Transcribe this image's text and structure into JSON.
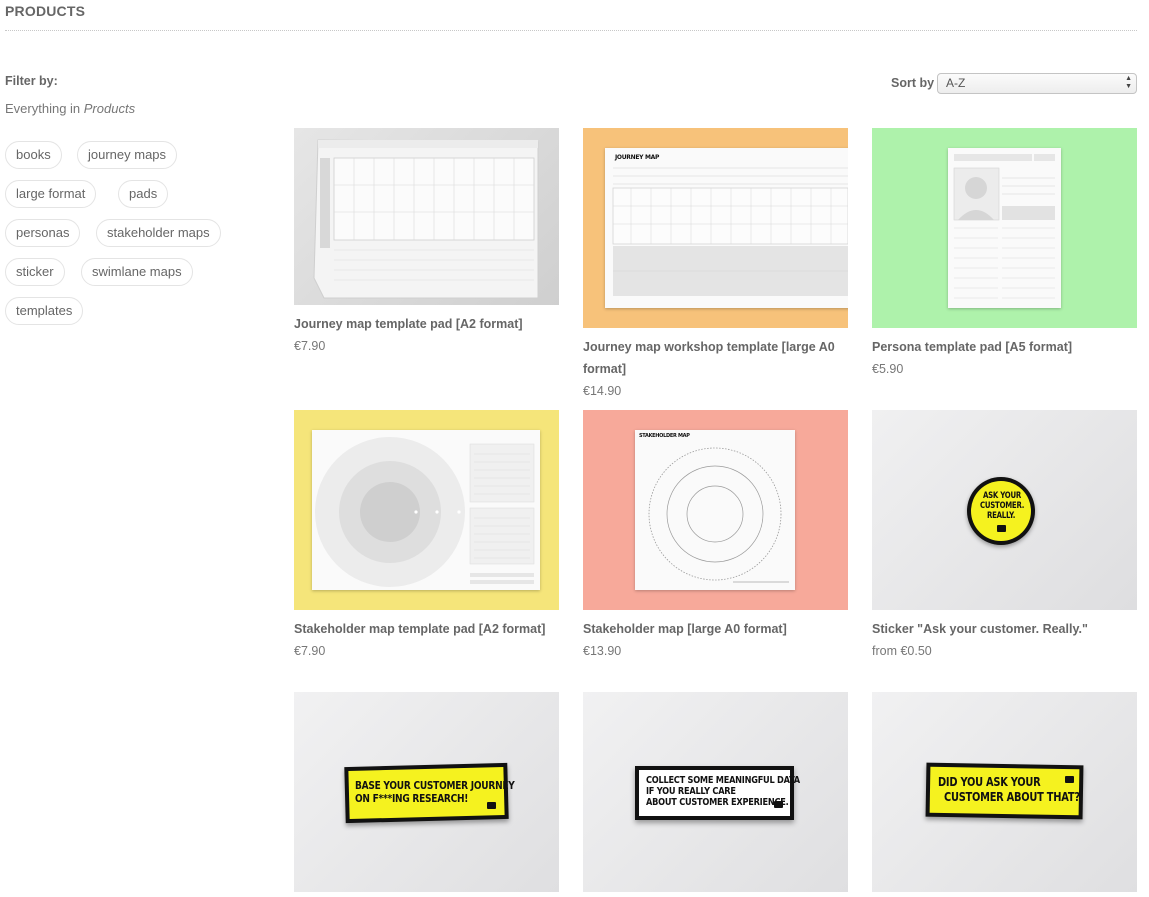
{
  "page": {
    "title": "PRODUCTS"
  },
  "filter": {
    "label": "Filter by:",
    "scope_prefix": "Everything in ",
    "scope_category": "Products",
    "tags": [
      "books",
      "journey maps",
      "large format",
      "pads",
      "personas",
      "stakeholder maps",
      "sticker",
      "swimlane maps",
      "templates"
    ]
  },
  "sort": {
    "label": "Sort by",
    "selected": "A-Z"
  },
  "products": [
    {
      "name": "Journey map template pad [A2 format]",
      "price": "€7.90",
      "bg": "#d9d9d9"
    },
    {
      "name": "Journey map workshop template [large A0 format]",
      "price": "€14.90",
      "bg": "#f7c27a"
    },
    {
      "name": "Persona template pad [A5 format]",
      "price": "€5.90",
      "bg": "#aef2ab"
    },
    {
      "name": "Stakeholder map template pad [A2 format]",
      "price": "€7.90",
      "bg": "#f5e57a"
    },
    {
      "name": "Stakeholder map [large A0 format]",
      "price": "€13.90",
      "bg": "#f7a99a"
    },
    {
      "name": "Sticker \"Ask your customer. Really.\"",
      "price": "from €0.50",
      "bg": "#e8e8e9"
    },
    {
      "name": "",
      "price": "",
      "bg": "#ececed"
    },
    {
      "name": "",
      "price": "",
      "bg": "#ececed"
    },
    {
      "name": "",
      "price": "",
      "bg": "#ececed"
    }
  ],
  "artwork": {
    "journey_map_heading": "JOURNEY MAP",
    "stakeholder_map_heading": "STAKEHOLDER MAP",
    "sticker_round": [
      "ASK YOUR",
      "CUSTOMER.",
      "REALLY."
    ],
    "sticker_research": [
      "BASE YOUR CUSTOMER JOURNEY",
      "ON F***ING RESEARCH!"
    ],
    "sticker_data": [
      "COLLECT SOME MEANINGFUL DATA",
      "IF YOU REALLY CARE",
      "ABOUT CUSTOMER EXPERIENCE."
    ],
    "sticker_ask": [
      "DID YOU ASK YOUR",
      "CUSTOMER ABOUT THAT?"
    ],
    "colors": {
      "sticker_yellow": "#f5f21f",
      "sticker_black": "#111111"
    }
  }
}
